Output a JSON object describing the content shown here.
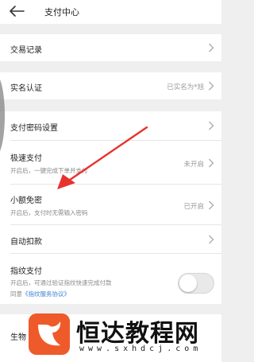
{
  "header": {
    "title": "支付中心",
    "back_icon": "arrow-left-icon"
  },
  "rows": [
    {
      "label": "交易记录",
      "chevron": true
    },
    {
      "label": "实名认证",
      "value": "已实名为*旭",
      "chevron": true
    },
    {
      "label": "支付密码设置",
      "chevron": true
    },
    {
      "label": "极速支付",
      "sub": "开启后，一键完成下单并支付",
      "value": "未开启",
      "chevron": true
    },
    {
      "label": "小额免密",
      "sub": "开启后，支付时无需输入密码",
      "value": "已开启",
      "chevron": true
    },
    {
      "label": "自动扣款",
      "chevron": true
    },
    {
      "label": "指纹支付",
      "sub": "开启后，可通过验证指纹快速完成付款",
      "agreement_prefix": "同意",
      "agreement_link": "《指纹服务协议》",
      "toggle_on": false
    },
    {
      "label": "生物"
    }
  ],
  "annotation": {
    "color": "#e8322d",
    "icon": "red-arrow-annotation"
  },
  "watermark": {
    "name": "恒达教程网",
    "url": "www.sxhdcj.com",
    "logo_color": "#ef5a2a"
  }
}
